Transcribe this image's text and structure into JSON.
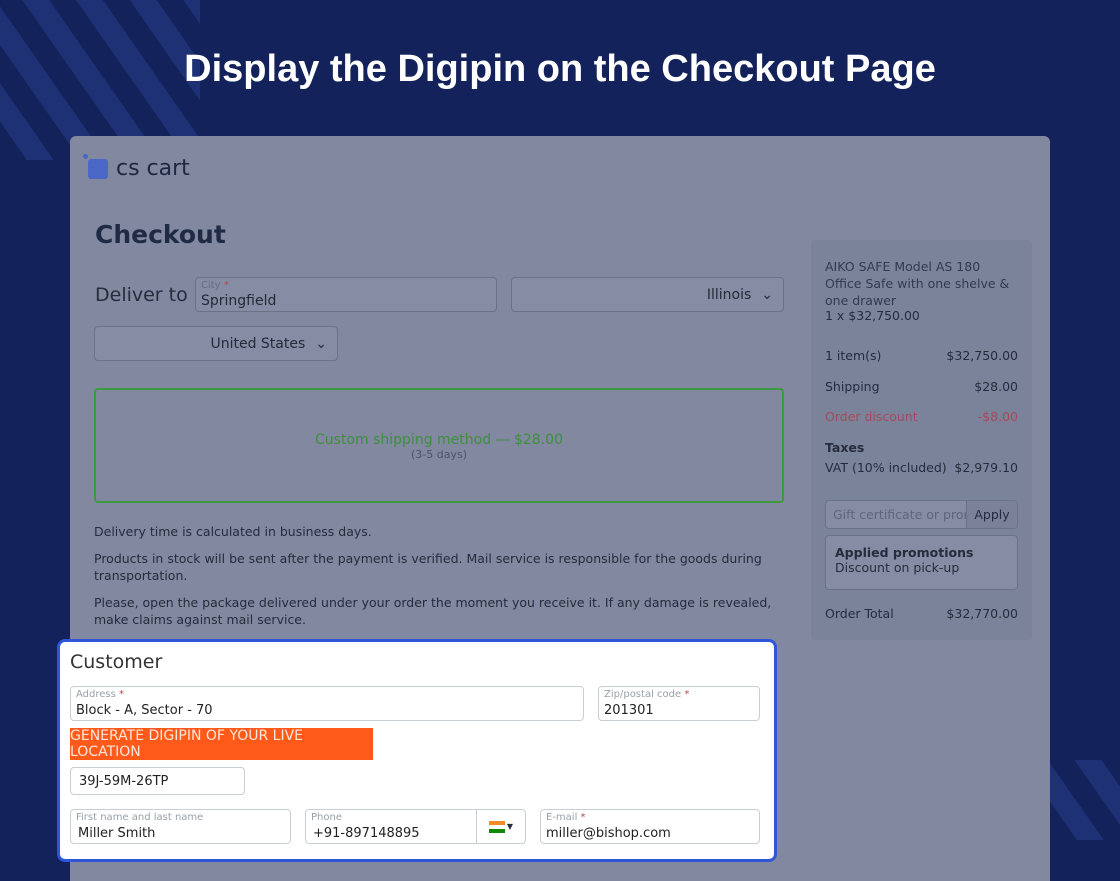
{
  "heading": "Display the Digipin on the Checkout Page",
  "logo": "cs cart",
  "page_title": "Checkout",
  "deliver": {
    "label": "Deliver to",
    "city_label": "City",
    "city": "Springfield",
    "state": "Illinois",
    "country": "United States"
  },
  "shipping": {
    "method": "Custom shipping method — $28.00",
    "days": "(3-5 days)"
  },
  "notes": [
    "Delivery time is calculated in business days.",
    "Products in stock will be sent after the payment is verified. Mail service is responsible for the goods during transportation.",
    "Please, open the package delivered under your order the moment you receive it. If any damage is revealed, make claims against mail service."
  ],
  "summary": {
    "product": "AIKO SAFE Model AS 180 Office Safe with one shelve & one drawer",
    "qty_price": "1 x $32,750.00",
    "items_label": "1 item(s)",
    "items_value": "$32,750.00",
    "shipping_label": "Shipping",
    "shipping_value": "$28.00",
    "discount_label": "Order discount",
    "discount_value": "-$8.00",
    "taxes_label": "Taxes",
    "vat_label": "VAT (10% included)",
    "vat_value": "$2,979.10",
    "promo_placeholder": "Gift certificate or promo code",
    "apply": "Apply",
    "promotions_title": "Applied promotions",
    "promotion": "Discount on pick-up",
    "total_label": "Order Total",
    "total_value": "$32,770.00"
  },
  "customer": {
    "title": "Customer",
    "address_label": "Address",
    "address": "Block - A, Sector - 70",
    "zip_label": "Zip/postal code",
    "zip": "201301",
    "digipin_button": "GENERATE DIGIPIN OF YOUR LIVE LOCATION",
    "digipin": "39J-59M-26TP",
    "name_label": "First name and last name",
    "name": "Miller Smith",
    "phone_label": "Phone",
    "phone": "+91-897148895",
    "email_label": "E-mail",
    "email": "miller@bishop.com"
  }
}
